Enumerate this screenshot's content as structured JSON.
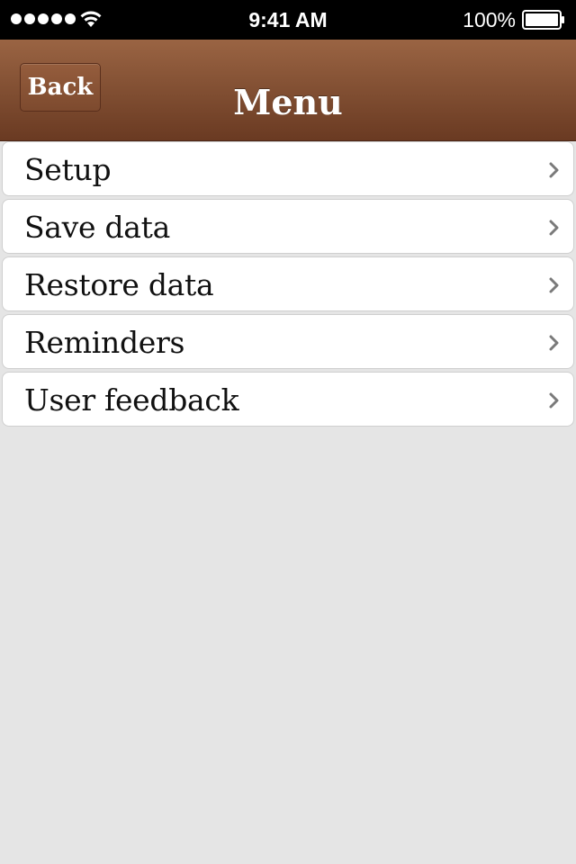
{
  "status_bar": {
    "time": "9:41 AM",
    "battery_percent": "100%",
    "signal_icon": "signal-dots-icon",
    "wifi_icon": "wifi-icon",
    "battery_icon": "battery-icon"
  },
  "nav": {
    "back_label": "Back",
    "title": "Menu",
    "color": "#7f4d31"
  },
  "menu": {
    "items": [
      {
        "label": "Setup",
        "icon": "chevron-right-icon"
      },
      {
        "label": "Save data",
        "icon": "chevron-right-icon"
      },
      {
        "label": "Restore data",
        "icon": "chevron-right-icon"
      },
      {
        "label": "Reminders",
        "icon": "chevron-right-icon"
      },
      {
        "label": "User feedback",
        "icon": "chevron-right-icon"
      }
    ]
  }
}
